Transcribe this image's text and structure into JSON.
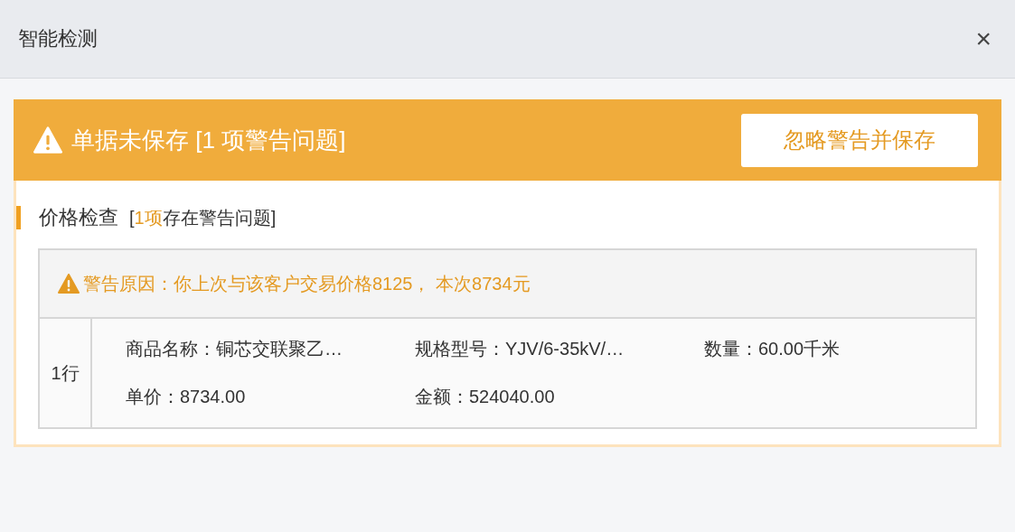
{
  "window": {
    "title": "智能检测",
    "close": "×"
  },
  "banner": {
    "title": "单据未保存 [1 项警告问题]",
    "button": "忽略警告并保存"
  },
  "section": {
    "title": "价格检查",
    "note": {
      "prefix": "[",
      "highlight": "1项",
      "suffix": "存在警告问题]"
    }
  },
  "warning": {
    "text": "警告原因：你上次与该客户交易价格8125， 本次8734元"
  },
  "rows": [
    {
      "label": "1行",
      "fields": [
        "商品名称：铜芯交联聚乙…",
        "规格型号：YJV/6-35kV/…",
        "数量：60.00千米",
        "单价：8734.00",
        "金额：524040.00"
      ]
    }
  ]
}
